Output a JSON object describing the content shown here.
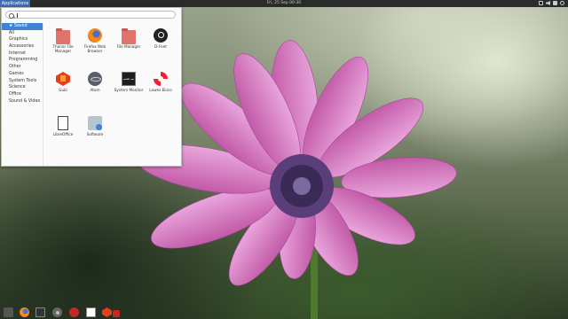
{
  "panel": {
    "applications_label": "Applications",
    "clock": "Fri, 25 Sep 00:30",
    "tray_icons": [
      "network-icon",
      "volume-icon",
      "battery-icon",
      "power-icon"
    ]
  },
  "menu": {
    "search": {
      "value": "",
      "placeholder": ""
    },
    "categories": [
      {
        "label": "★ Saved",
        "active": true
      },
      {
        "label": "All"
      },
      {
        "label": "Graphics"
      },
      {
        "label": "Accessories"
      },
      {
        "label": "Internet"
      },
      {
        "label": "Programming"
      },
      {
        "label": "Other"
      },
      {
        "label": "Games"
      },
      {
        "label": "System Tools"
      },
      {
        "label": "Science"
      },
      {
        "label": "Office"
      },
      {
        "label": "Sound & Video"
      }
    ],
    "apps": [
      {
        "label": "Thunar File Manager",
        "icon": "folder-icon"
      },
      {
        "label": "Firefox Web Browser",
        "icon": "firefox-icon"
      },
      {
        "label": "File Manager",
        "icon": "folder-icon"
      },
      {
        "label": "D-Feet",
        "icon": "d-feet-icon"
      },
      {
        "label": "Gubi",
        "icon": "gubi-icon"
      },
      {
        "label": "Atom",
        "icon": "atom-icon"
      },
      {
        "label": "System Monitor",
        "icon": "system-monitor-icon"
      },
      {
        "label": "Lowes Ekico",
        "icon": "lifebuoy-icon"
      },
      {
        "label": "LibreOffice",
        "icon": "document-icon"
      },
      {
        "label": "Software",
        "icon": "software-icon"
      }
    ]
  },
  "dock": {
    "items": [
      "files-icon",
      "firefox-icon",
      "terminal-icon",
      "settings-icon",
      "help-icon",
      "document-icon",
      "gubi-icon",
      "app-icon"
    ]
  }
}
